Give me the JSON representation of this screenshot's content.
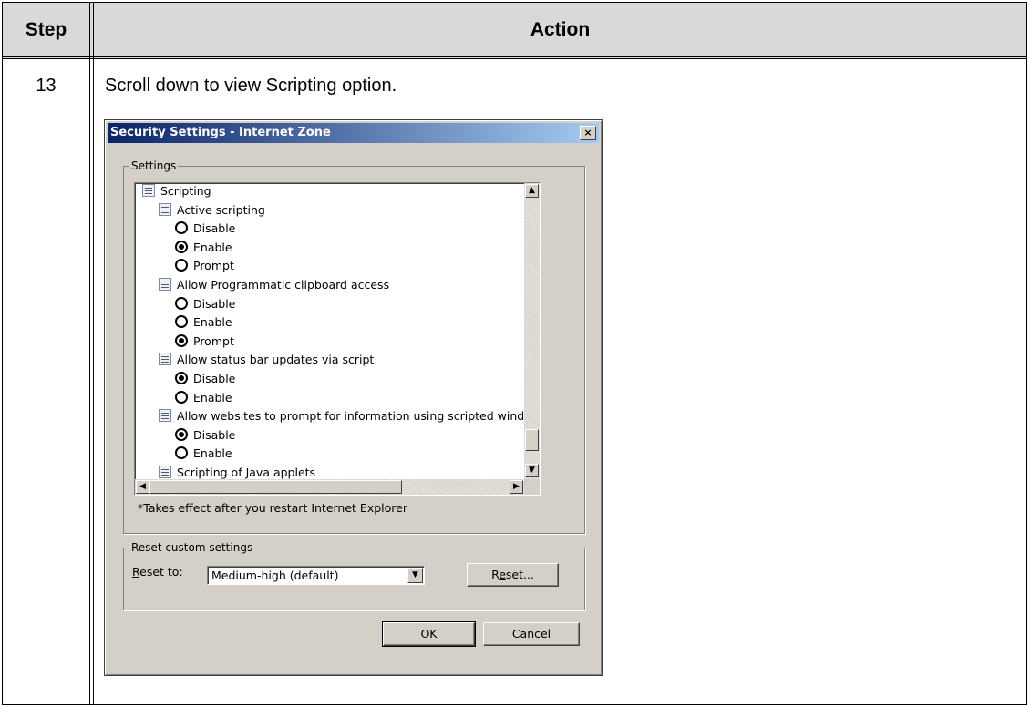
{
  "table": {
    "header_step": "Step",
    "header_action": "Action",
    "step_number": "13",
    "instruction": "Scroll down to view Scripting option."
  },
  "dialog": {
    "title": "Security Settings - Internet Zone",
    "close_glyph": "×",
    "settings_legend": "Settings",
    "tree": [
      {
        "kind": "icon",
        "label": "Scripting"
      },
      {
        "kind": "icon",
        "label": "Active scripting"
      },
      {
        "kind": "radio",
        "label": "Disable",
        "checked": false
      },
      {
        "kind": "radio",
        "label": "Enable",
        "checked": true
      },
      {
        "kind": "radio",
        "label": "Prompt",
        "checked": false
      },
      {
        "kind": "icon",
        "label": "Allow Programmatic clipboard access"
      },
      {
        "kind": "radio",
        "label": "Disable",
        "checked": false
      },
      {
        "kind": "radio",
        "label": "Enable",
        "checked": false
      },
      {
        "kind": "radio",
        "label": "Prompt",
        "checked": true
      },
      {
        "kind": "icon",
        "label": "Allow status bar updates via script"
      },
      {
        "kind": "radio",
        "label": "Disable",
        "checked": true
      },
      {
        "kind": "radio",
        "label": "Enable",
        "checked": false
      },
      {
        "kind": "icon",
        "label": "Allow websites to prompt for information using scripted windo"
      },
      {
        "kind": "radio",
        "label": "Disable",
        "checked": true
      },
      {
        "kind": "radio",
        "label": "Enable",
        "checked": false
      },
      {
        "kind": "icon",
        "label": "Scripting of Java applets"
      }
    ],
    "note": "*Takes effect after you restart Internet Explorer",
    "reset_legend": "Reset custom settings",
    "reset_to_label_acc": "R",
    "reset_to_label_rest": "eset to:",
    "reset_to_value": "Medium-high (default)",
    "reset_button_pre": "R",
    "reset_button_acc": "e",
    "reset_button_post": "set...",
    "ok_label": "OK",
    "cancel_label": "Cancel",
    "scroll_up": "▲",
    "scroll_down": "▼",
    "scroll_left": "◀",
    "scroll_right": "▶",
    "combo_arrow": "▼"
  }
}
